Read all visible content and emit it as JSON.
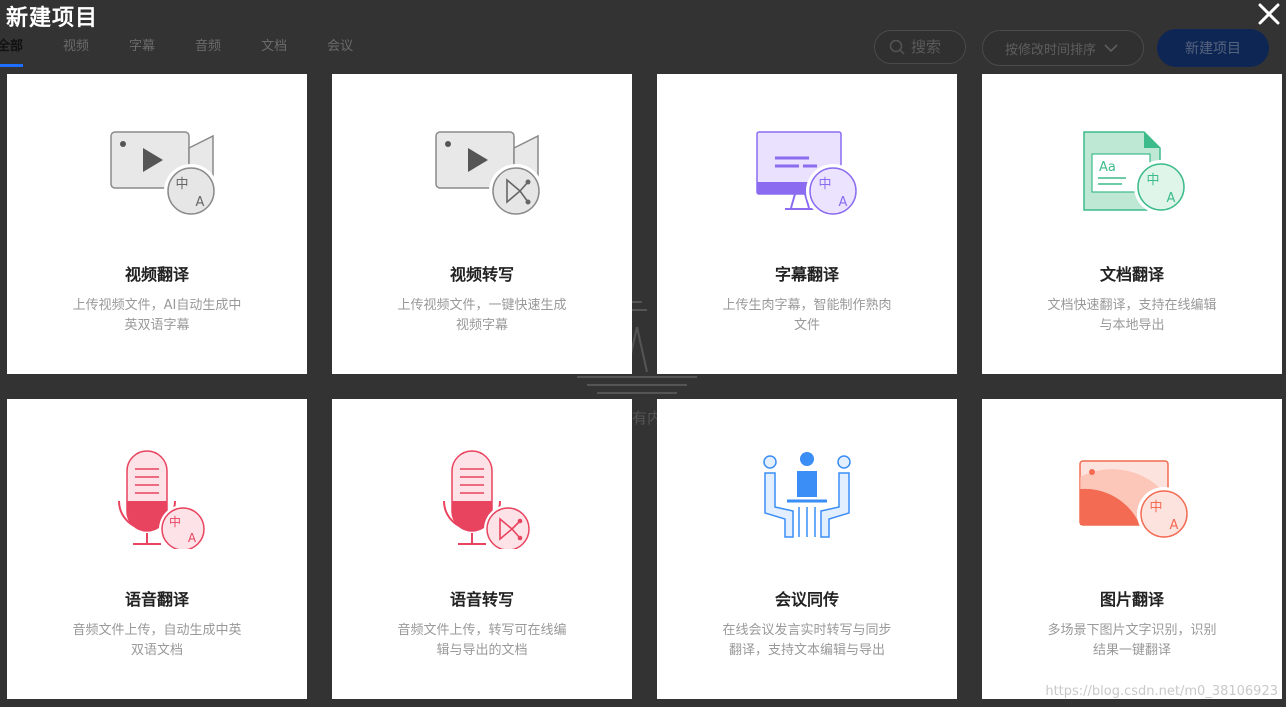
{
  "dialog": {
    "title": "新建项目",
    "close_label": "×"
  },
  "tabs": [
    {
      "label": "全部",
      "active": true
    },
    {
      "label": "视频",
      "active": false
    },
    {
      "label": "字幕",
      "active": false
    },
    {
      "label": "音频",
      "active": false
    },
    {
      "label": "文档",
      "active": false
    },
    {
      "label": "会议",
      "active": false
    }
  ],
  "toolbar": {
    "search_placeholder": "搜索",
    "sort_label": "按修改时间排序",
    "new_project_label": "新建项目"
  },
  "background_hint": "有内",
  "cards": [
    {
      "title": "视频翻译",
      "desc": "上传视频文件，AI自动生成中英双语字幕",
      "icon": "video-translate-icon"
    },
    {
      "title": "视频转写",
      "desc": "上传视频文件，一键快速生成视频字幕",
      "icon": "video-transcribe-icon"
    },
    {
      "title": "字幕翻译",
      "desc": "上传生肉字幕，智能制作熟肉文件",
      "icon": "subtitle-translate-icon"
    },
    {
      "title": "文档翻译",
      "desc": "文档快速翻译，支持在线编辑与本地导出",
      "icon": "document-translate-icon"
    },
    {
      "title": "语音翻译",
      "desc": "音频文件上传，自动生成中英双语文档",
      "icon": "audio-translate-icon"
    },
    {
      "title": "语音转写",
      "desc": "音频文件上传，转写可在线编辑与导出的文档",
      "icon": "audio-transcribe-icon"
    },
    {
      "title": "会议同传",
      "desc": "在线会议发言实时转写与同步翻译，支持文本编辑与导出",
      "icon": "meeting-interpret-icon"
    },
    {
      "title": "图片翻译",
      "desc": "多场景下图片文字识别，识别结果一键翻译",
      "icon": "image-translate-icon"
    }
  ],
  "watermark": "https://blog.csdn.net/m0_38106923",
  "colors": {
    "overlay": "#333333",
    "primary": "#1e6fff",
    "video_gray": "#8a8a8a",
    "subtitle_purple": "#8b6cf0",
    "document_green": "#3dbb8a",
    "audio_red": "#e8435f",
    "meeting_blue": "#3a8ef5",
    "image_orange": "#f26b52"
  }
}
